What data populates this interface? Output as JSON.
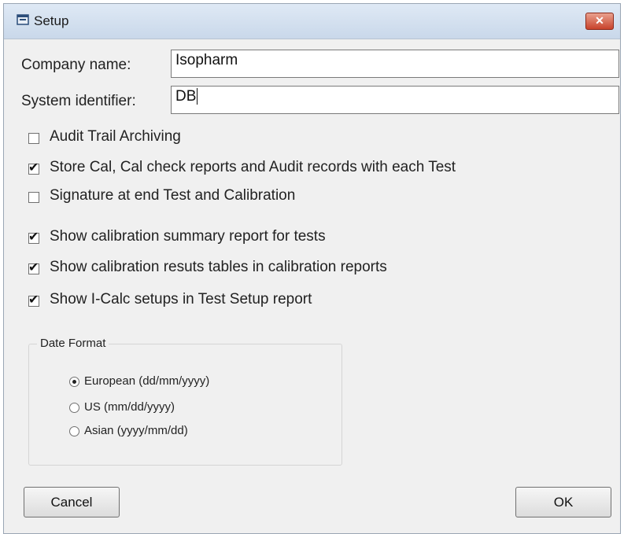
{
  "window": {
    "title": "Setup",
    "close_label": "✕"
  },
  "form": {
    "company_label": "Company name:",
    "company_value": "Isopharm",
    "system_label": "System identifier:",
    "system_value": "DB"
  },
  "options": [
    {
      "label": "Audit Trail Archiving",
      "checked": false
    },
    {
      "label": "Store Cal, Cal check reports and Audit records with each Test",
      "checked": true
    },
    {
      "label": "Signature at end Test and Calibration",
      "checked": false
    },
    {
      "label": "Show calibration summary report for tests",
      "checked": true
    },
    {
      "label": "Show calibration resuts tables in calibration reports",
      "checked": true
    },
    {
      "label": "Show I-Calc setups in Test Setup report",
      "checked": true
    }
  ],
  "date_format": {
    "legend": "Date Format",
    "options": [
      {
        "label": "European (dd/mm/yyyy)",
        "selected": true
      },
      {
        "label": "US (mm/dd/yyyy)",
        "selected": false
      },
      {
        "label": "Asian (yyyy/mm/dd)",
        "selected": false
      }
    ]
  },
  "buttons": {
    "cancel": "Cancel",
    "ok": "OK"
  },
  "colors": {
    "title_bar": "#c9d8ea",
    "close_button": "#c8432c",
    "dialog_background": "#f0f0f0"
  }
}
